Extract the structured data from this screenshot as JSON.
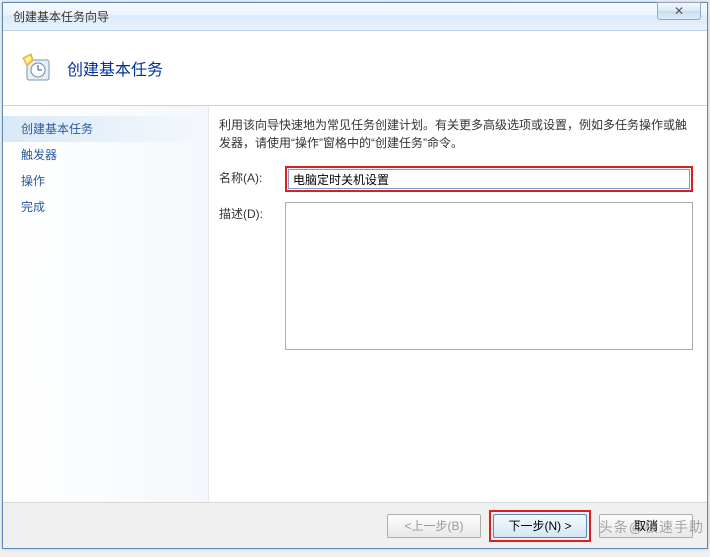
{
  "window": {
    "title": "创建基本任务向导",
    "close_symbol": "✕"
  },
  "header": {
    "title": "创建基本任务"
  },
  "sidebar": {
    "items": [
      {
        "label": "创建基本任务",
        "active": true
      },
      {
        "label": "触发器",
        "active": false
      },
      {
        "label": "操作",
        "active": false
      },
      {
        "label": "完成",
        "active": false
      }
    ]
  },
  "main": {
    "instruction": "利用该向导快速地为常见任务创建计划。有关更多高级选项或设置，例如多任务操作或触发器，请使用“操作”窗格中的“创建任务”命令。",
    "name_label": "名称(A):",
    "name_value": "电脑定时关机设置",
    "desc_label": "描述(D):",
    "desc_value": ""
  },
  "footer": {
    "back_label": "<上一步(B)",
    "next_label": "下一步(N) >",
    "cancel_label": "取消"
  },
  "watermark": "头条@极速手助"
}
